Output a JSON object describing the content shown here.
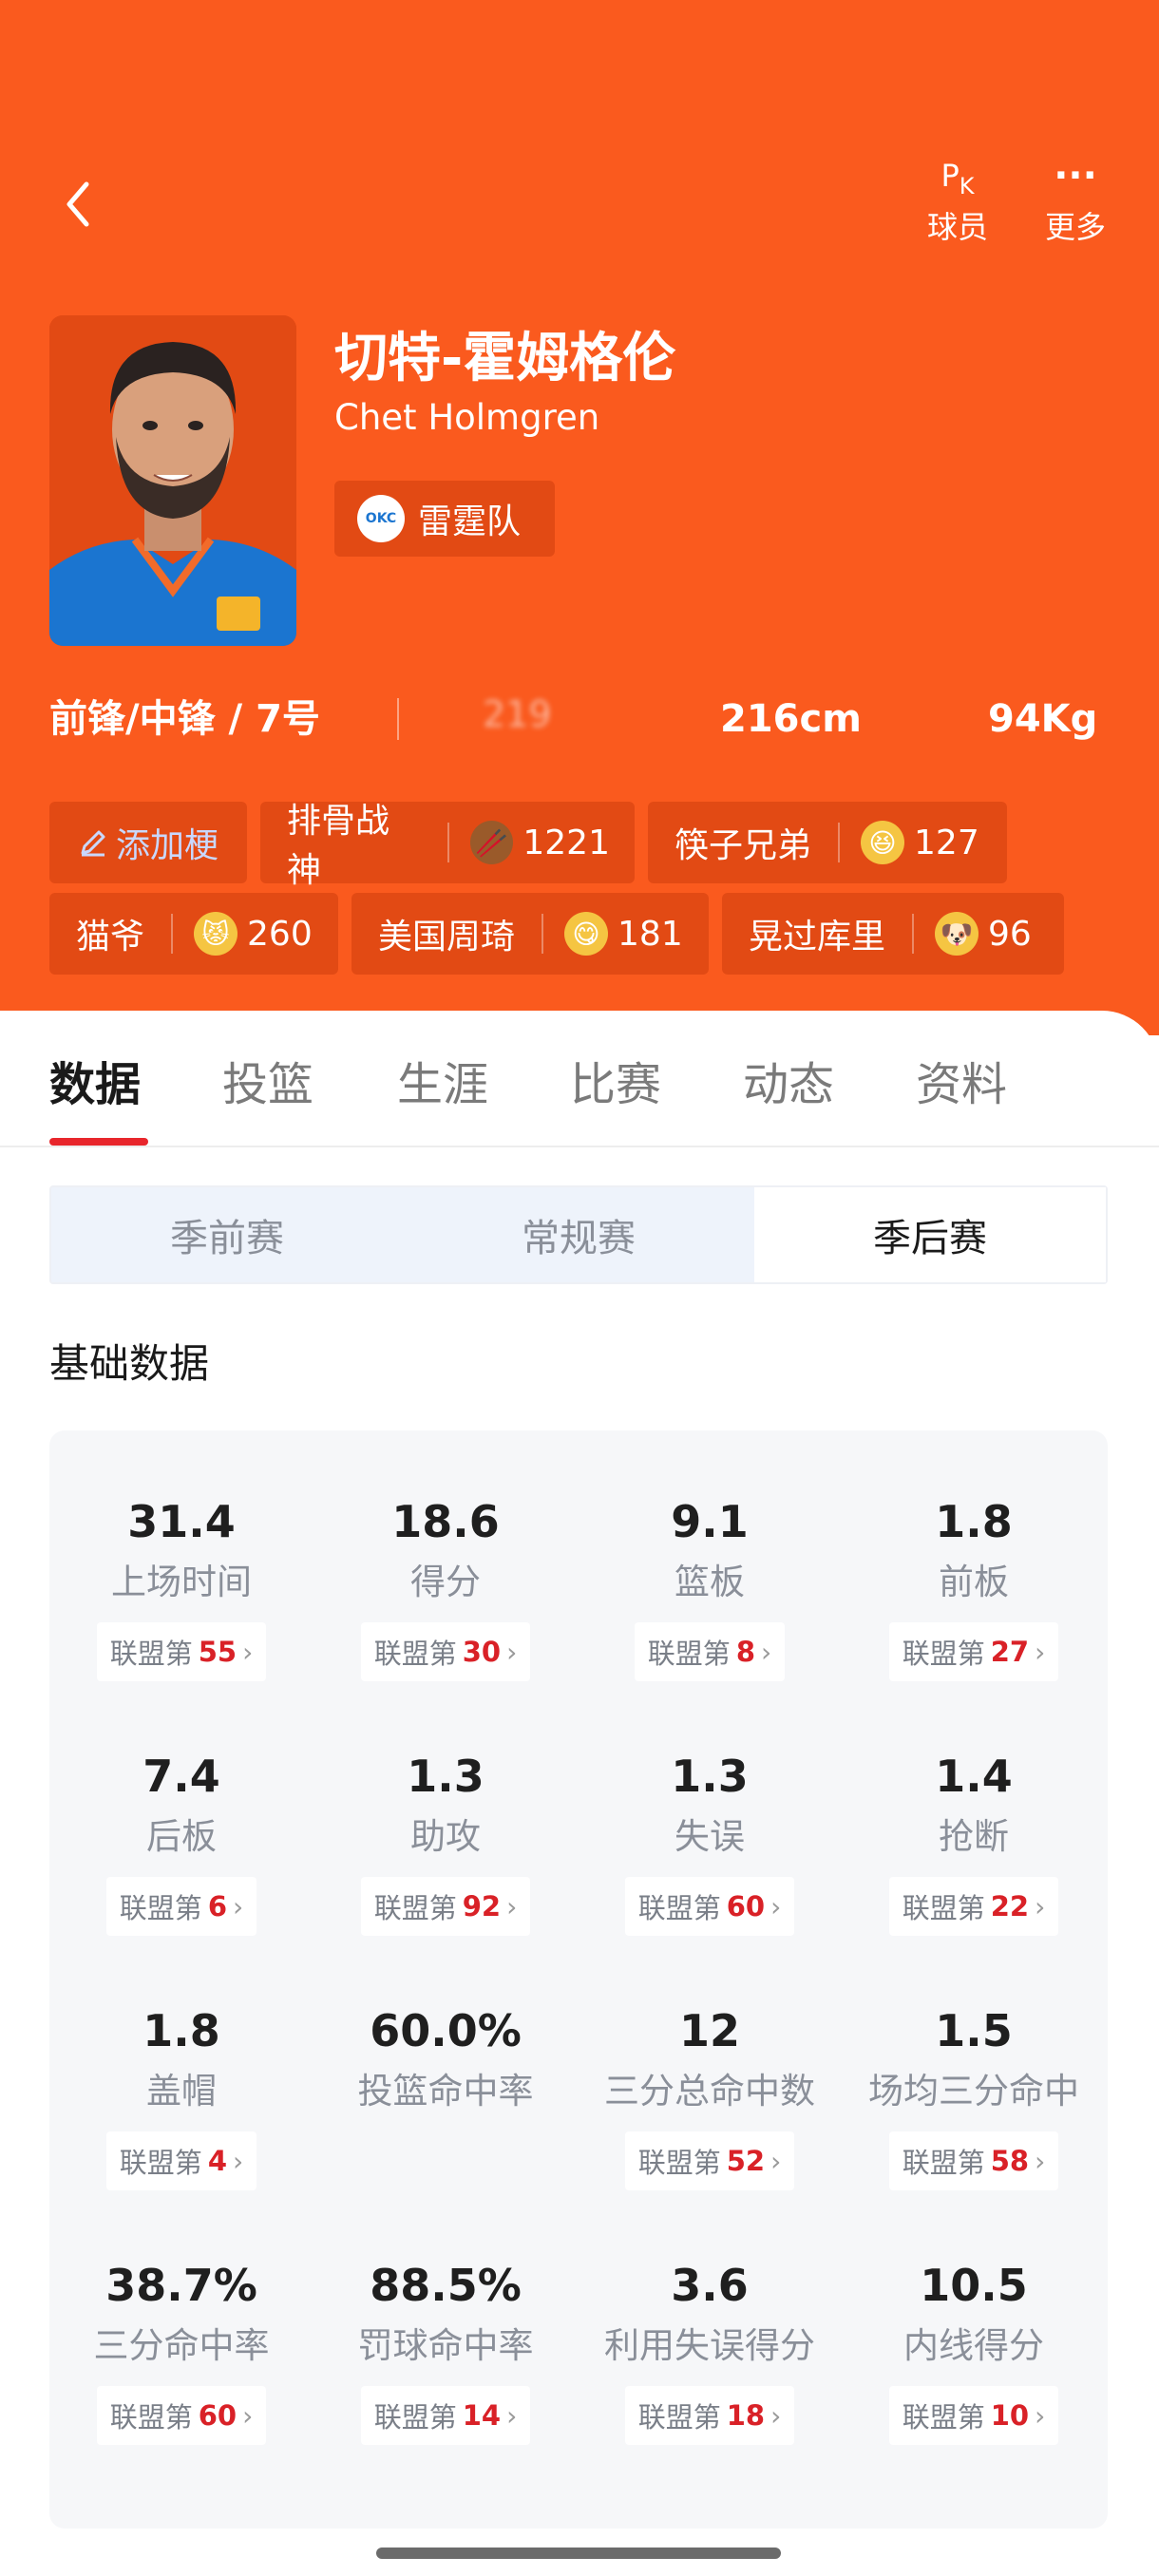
{
  "topbar": {
    "pk_glyph": "PK",
    "players_label": "球员",
    "more_glyph": "···",
    "more_label": "更多"
  },
  "player": {
    "name_cn": "切特-霍姆格伦",
    "name_en": "Chet Holmgren",
    "team": "雷霆队",
    "team_logo_text": "OKC",
    "position": "前锋/中锋 / 7号",
    "blurred": "219",
    "height": "216cm",
    "weight": "94Kg"
  },
  "tags": {
    "add_label": "添加梗",
    "items": [
      {
        "label": "排骨战神",
        "count": "1221",
        "emoji": "🥢"
      },
      {
        "label": "筷子兄弟",
        "count": "127",
        "emoji": "😆"
      },
      {
        "label": "猫爷",
        "count": "260",
        "emoji": "😾"
      },
      {
        "label": "美国周琦",
        "count": "181",
        "emoji": "😋"
      },
      {
        "label": "晃过库里",
        "count": "96",
        "emoji": "🐶"
      }
    ]
  },
  "tabs": [
    "数据",
    "投篮",
    "生涯",
    "比赛",
    "动态",
    "资料"
  ],
  "segments": [
    "季前赛",
    "常规赛",
    "季后赛"
  ],
  "section_title": "基础数据",
  "rank_prefix": "联盟第",
  "stats": [
    {
      "value": "31.4",
      "label": "上场时间",
      "rank": "55"
    },
    {
      "value": "18.6",
      "label": "得分",
      "rank": "30"
    },
    {
      "value": "9.1",
      "label": "篮板",
      "rank": "8"
    },
    {
      "value": "1.8",
      "label": "前板",
      "rank": "27"
    },
    {
      "value": "7.4",
      "label": "后板",
      "rank": "6"
    },
    {
      "value": "1.3",
      "label": "助攻",
      "rank": "92"
    },
    {
      "value": "1.3",
      "label": "失误",
      "rank": "60"
    },
    {
      "value": "1.4",
      "label": "抢断",
      "rank": "22"
    },
    {
      "value": "1.8",
      "label": "盖帽",
      "rank": "4"
    },
    {
      "value": "60.0%",
      "label": "投篮命中率",
      "rank": ""
    },
    {
      "value": "12",
      "label": "三分总命中数",
      "rank": "52"
    },
    {
      "value": "1.5",
      "label": "场均三分命中",
      "rank": "58"
    },
    {
      "value": "38.7%",
      "label": "三分命中率",
      "rank": "60"
    },
    {
      "value": "88.5%",
      "label": "罚球命中率",
      "rank": "14"
    },
    {
      "value": "3.6",
      "label": "利用失误得分",
      "rank": "18"
    },
    {
      "value": "10.5",
      "label": "内线得分",
      "rank": "10"
    }
  ],
  "colors": {
    "brand_orange": "#fa5a1e",
    "tag_bg": "#e24a14",
    "rank_red": "#d92127",
    "tab_underline": "#e8262c"
  }
}
